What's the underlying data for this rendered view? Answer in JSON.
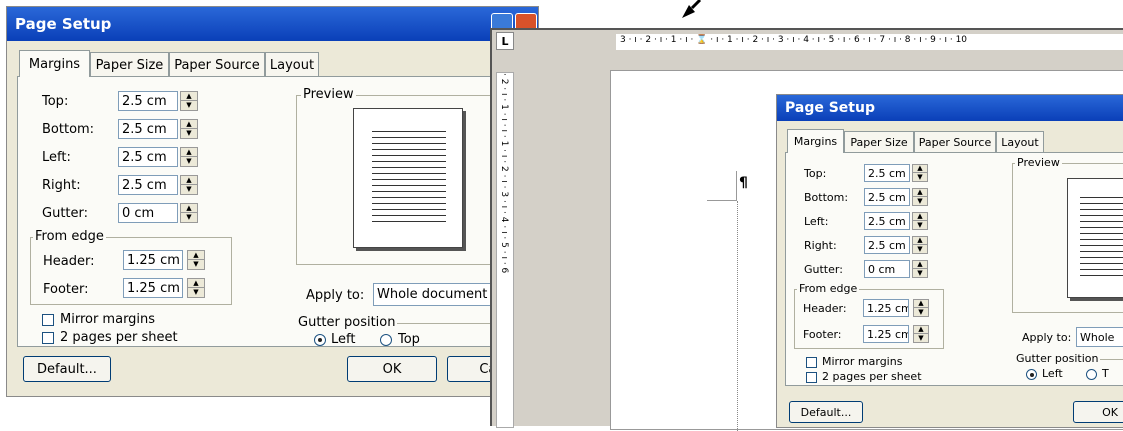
{
  "dialog": {
    "title": "Page Setup",
    "tabs": [
      "Margins",
      "Paper Size",
      "Paper Source",
      "Layout"
    ],
    "fields": {
      "top": {
        "label": "Top:",
        "value": "2.5 cm"
      },
      "bottom": {
        "label": "Bottom:",
        "value": "2.5 cm"
      },
      "left": {
        "label": "Left:",
        "value": "2.5 cm"
      },
      "right": {
        "label": "Right:",
        "value": "2.5 cm"
      },
      "gutter": {
        "label": "Gutter:",
        "value": "0 cm"
      },
      "header": {
        "label": "Header:",
        "value": "1.25 cm"
      },
      "footer": {
        "label": "Footer:",
        "value": "1.25 cm"
      }
    },
    "from_edge": "From edge",
    "preview": "Preview",
    "apply_to_label": "Apply to:",
    "apply_to_value": "Whole document",
    "apply_to_value_short": "Whole",
    "mirror": "Mirror margins",
    "two_pages": "2 pages per sheet",
    "gutter_position": "Gutter position",
    "radio_left": "Left",
    "radio_top": "Top",
    "radio_top_short": "T",
    "default": "Default...",
    "ok": "OK",
    "cancel": "Can"
  },
  "ruler": {
    "horizontal": "3 · ı · 2 · ı · 1 · ı · ⌛ · ı · 1 · ı · 2 · ı · 3 · ı · 4 · ı · 5 · ı · 6 · ı · 7 · ı · 8 · ı · 9 · ı · 10",
    "vertical": "· 2 · ı · 1 · ı · ı · 1 · ı · 2 · ı · 3 · ı · 4 · ı · 5 · ı · 6",
    "corner": "L"
  },
  "colors": {
    "titlebar": "#0a3fb8",
    "dialog": "#ece9d8",
    "workspace": "#d4d0c8"
  }
}
